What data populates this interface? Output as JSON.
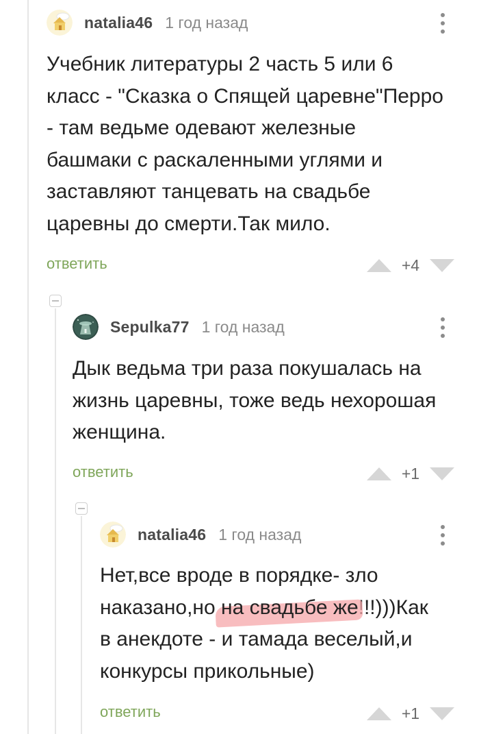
{
  "comments": [
    {
      "author": "natalia46",
      "time": "1 год назад",
      "text_lines": [
        "Учебник литературы 2 часть 5 или 6",
        "класс - \"Сказка о Спящей царевне\"Перро",
        "- там ведьме одевают железные",
        "башмаки с раскаленными углями и",
        "заставляют танцевать на свадьбе",
        "царевны до смерти.Так мило."
      ],
      "reply_label": "ответить",
      "score": "+4"
    },
    {
      "author": "Sepulka77",
      "time": "1 год назад",
      "text_lines": [
        "Дык ведьма три раза покушалась на",
        "жизнь царевны, тоже ведь нехорошая",
        "женщина."
      ],
      "reply_label": "ответить",
      "score": "+1"
    },
    {
      "author": "natalia46",
      "time": "1 год назад",
      "line1": "Нет,все вроде в порядке- зло",
      "line2_before": "наказано,но ",
      "line2_highlight": "на свадьбе же",
      "line2_after": "!!!)))Как",
      "line3": "в анекдоте - и тамада веселый,и",
      "line4": "конкурсы прикольные)",
      "reply_label": "ответить",
      "score": "+1"
    }
  ],
  "colors": {
    "reply": "#7fa65a",
    "highlight": "#f6a7aa",
    "vote_arrow": "#d6d6d6"
  },
  "icons": [
    "kebab-menu-icon",
    "collapse-thread-icon",
    "vote-up-icon",
    "vote-down-icon",
    "house-avatar",
    "spacecraft-avatar"
  ]
}
